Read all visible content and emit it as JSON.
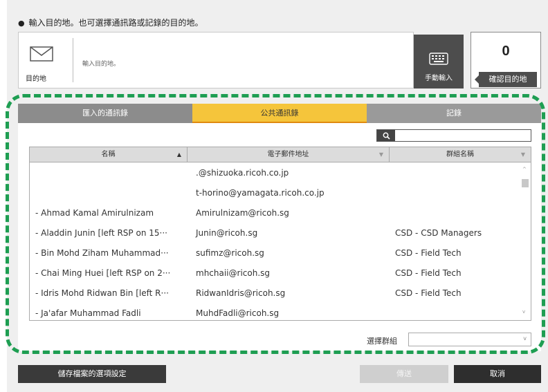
{
  "instruction": "輸入目的地。也可選擇通訊路或記錄的目的地。",
  "destination": {
    "label": "目的地",
    "placeholder": "輸入目的地。",
    "icon": "envelope-icon"
  },
  "manual_input": {
    "label": "手動輸入",
    "icon": "keyboard-icon"
  },
  "confirm": {
    "count": "0",
    "label": "確認目的地"
  },
  "tabs": [
    {
      "label": "匯入的通訊錄",
      "active": false
    },
    {
      "label": "公共通訊錄",
      "active": true
    },
    {
      "label": "記錄",
      "active": false
    }
  ],
  "search": {
    "value": "",
    "icon": "search-icon"
  },
  "table": {
    "columns": [
      "名稱",
      "電子郵件地址",
      "群組名稱"
    ],
    "rows": [
      {
        "name": "",
        "email": ".@shizuoka.ricoh.co.jp",
        "group": ""
      },
      {
        "name": "",
        "email": "t-horino@yamagata.ricoh.co.jp",
        "group": ""
      },
      {
        "name": "- Ahmad Kamal Amirulnizam",
        "email": "Amirulnizam@ricoh.sg",
        "group": ""
      },
      {
        "name": "- Aladdin Junin [left RSP on 15···",
        "email": "Junin@ricoh.sg",
        "group": "CSD - CSD Managers"
      },
      {
        "name": "- Bin Mohd Ziham Muhammad···",
        "email": "sufimz@ricoh.sg",
        "group": "CSD - Field Tech"
      },
      {
        "name": "- Chai Ming Huei [left RSP on 2···",
        "email": "mhchaii@ricoh.sg",
        "group": "CSD - Field Tech"
      },
      {
        "name": "- Idris Mohd Ridwan Bin [left R···",
        "email": "RidwanIdris@ricoh.sg",
        "group": "CSD - Field Tech"
      },
      {
        "name": "- Ja'afar Muhammad Fadli",
        "email": "MuhdFadli@ricoh.sg",
        "group": ""
      }
    ]
  },
  "group_select": {
    "label": "選擇群組",
    "value": ""
  },
  "buttons": {
    "save_options": "儲存檔案的選項設定",
    "send": "傳送",
    "cancel": "取消"
  },
  "colors": {
    "active_tab": "#f5c53b",
    "highlight_dash": "#1e9e52",
    "dark_button": "#3a3a3a"
  }
}
